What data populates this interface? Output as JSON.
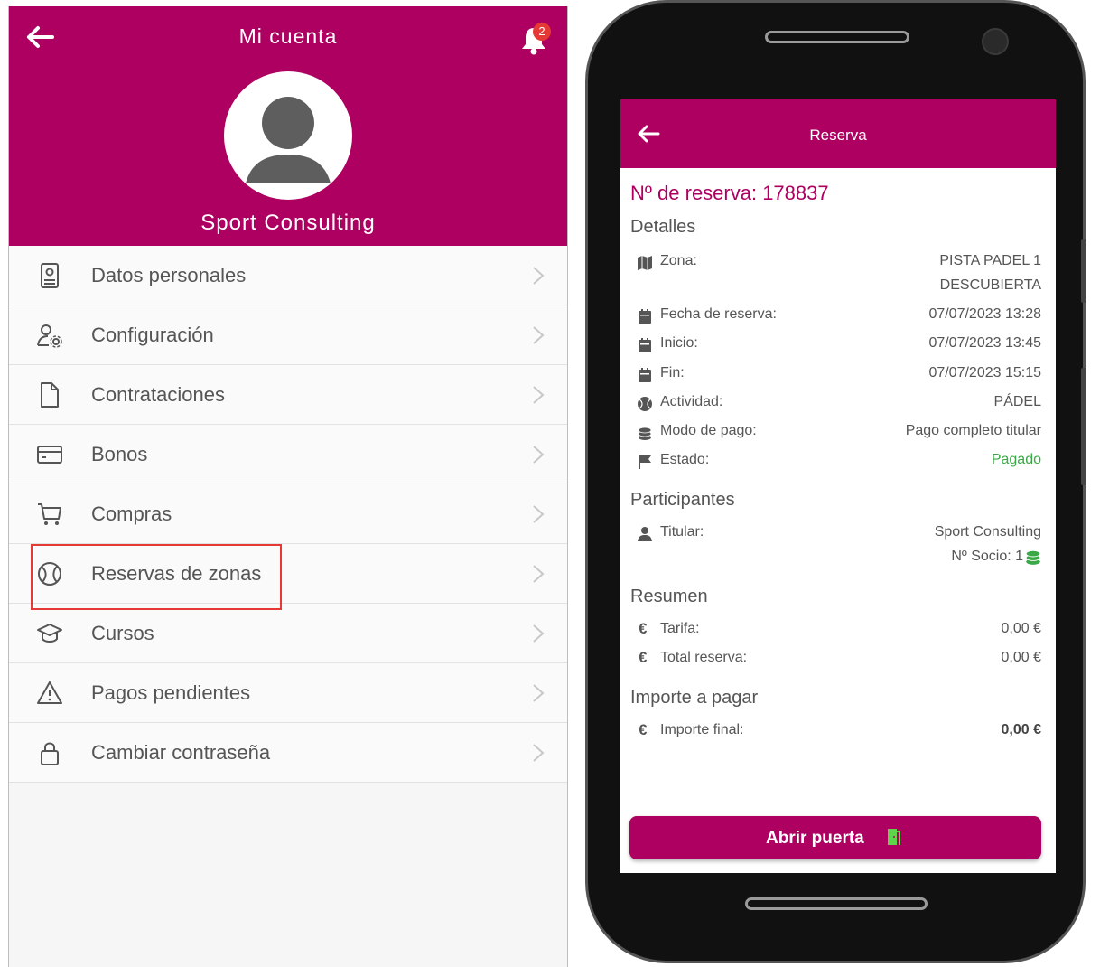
{
  "left": {
    "header": {
      "title": "Mi cuenta",
      "notification_count": "2",
      "user_name": "Sport Consulting"
    },
    "menu": [
      {
        "label": "Datos personales",
        "icon": "id-card-icon"
      },
      {
        "label": "Configuración",
        "icon": "user-settings-icon"
      },
      {
        "label": "Contrataciones",
        "icon": "document-icon"
      },
      {
        "label": "Bonos",
        "icon": "card-icon"
      },
      {
        "label": "Compras",
        "icon": "cart-icon"
      },
      {
        "label": "Reservas de zonas",
        "icon": "ball-icon",
        "highlighted": true
      },
      {
        "label": "Cursos",
        "icon": "graduation-cap-icon"
      },
      {
        "label": "Pagos pendientes",
        "icon": "warning-icon"
      },
      {
        "label": "Cambiar contraseña",
        "icon": "lock-icon"
      }
    ]
  },
  "phone": {
    "header": {
      "title": "Reserva"
    },
    "reservation_number": "Nº de reserva: 178837",
    "sections": {
      "details": "Detalles",
      "participants": "Participantes",
      "summary": "Resumen",
      "payment": "Importe a pagar"
    },
    "details": {
      "zona_label": "Zona:",
      "zona_value_line1": "PISTA PADEL 1",
      "zona_value_line2": "DESCUBIERTA",
      "fecha_label": "Fecha de reserva:",
      "fecha_value": "07/07/2023 13:28",
      "inicio_label": "Inicio:",
      "inicio_value": "07/07/2023 13:45",
      "fin_label": "Fin:",
      "fin_value": "07/07/2023 15:15",
      "actividad_label": "Actividad:",
      "actividad_value": "PÁDEL",
      "modo_label": "Modo de pago:",
      "modo_value": "Pago completo titular",
      "estado_label": "Estado:",
      "estado_value": "Pagado"
    },
    "participants": {
      "titular_label": "Titular:",
      "titular_name": "Sport Consulting",
      "socio": "Nº Socio: 1"
    },
    "summary": {
      "tarifa_label": "Tarifa:",
      "tarifa_value": "0,00 €",
      "total_label": "Total reserva:",
      "total_value": "0,00 €"
    },
    "payment": {
      "final_label": "Importe final:",
      "final_value": "0,00 €"
    },
    "open_door_button": "Abrir puerta"
  },
  "colors": {
    "brand": "#ad0060",
    "paid_green": "#3aa845",
    "highlight_red": "#e53935"
  }
}
